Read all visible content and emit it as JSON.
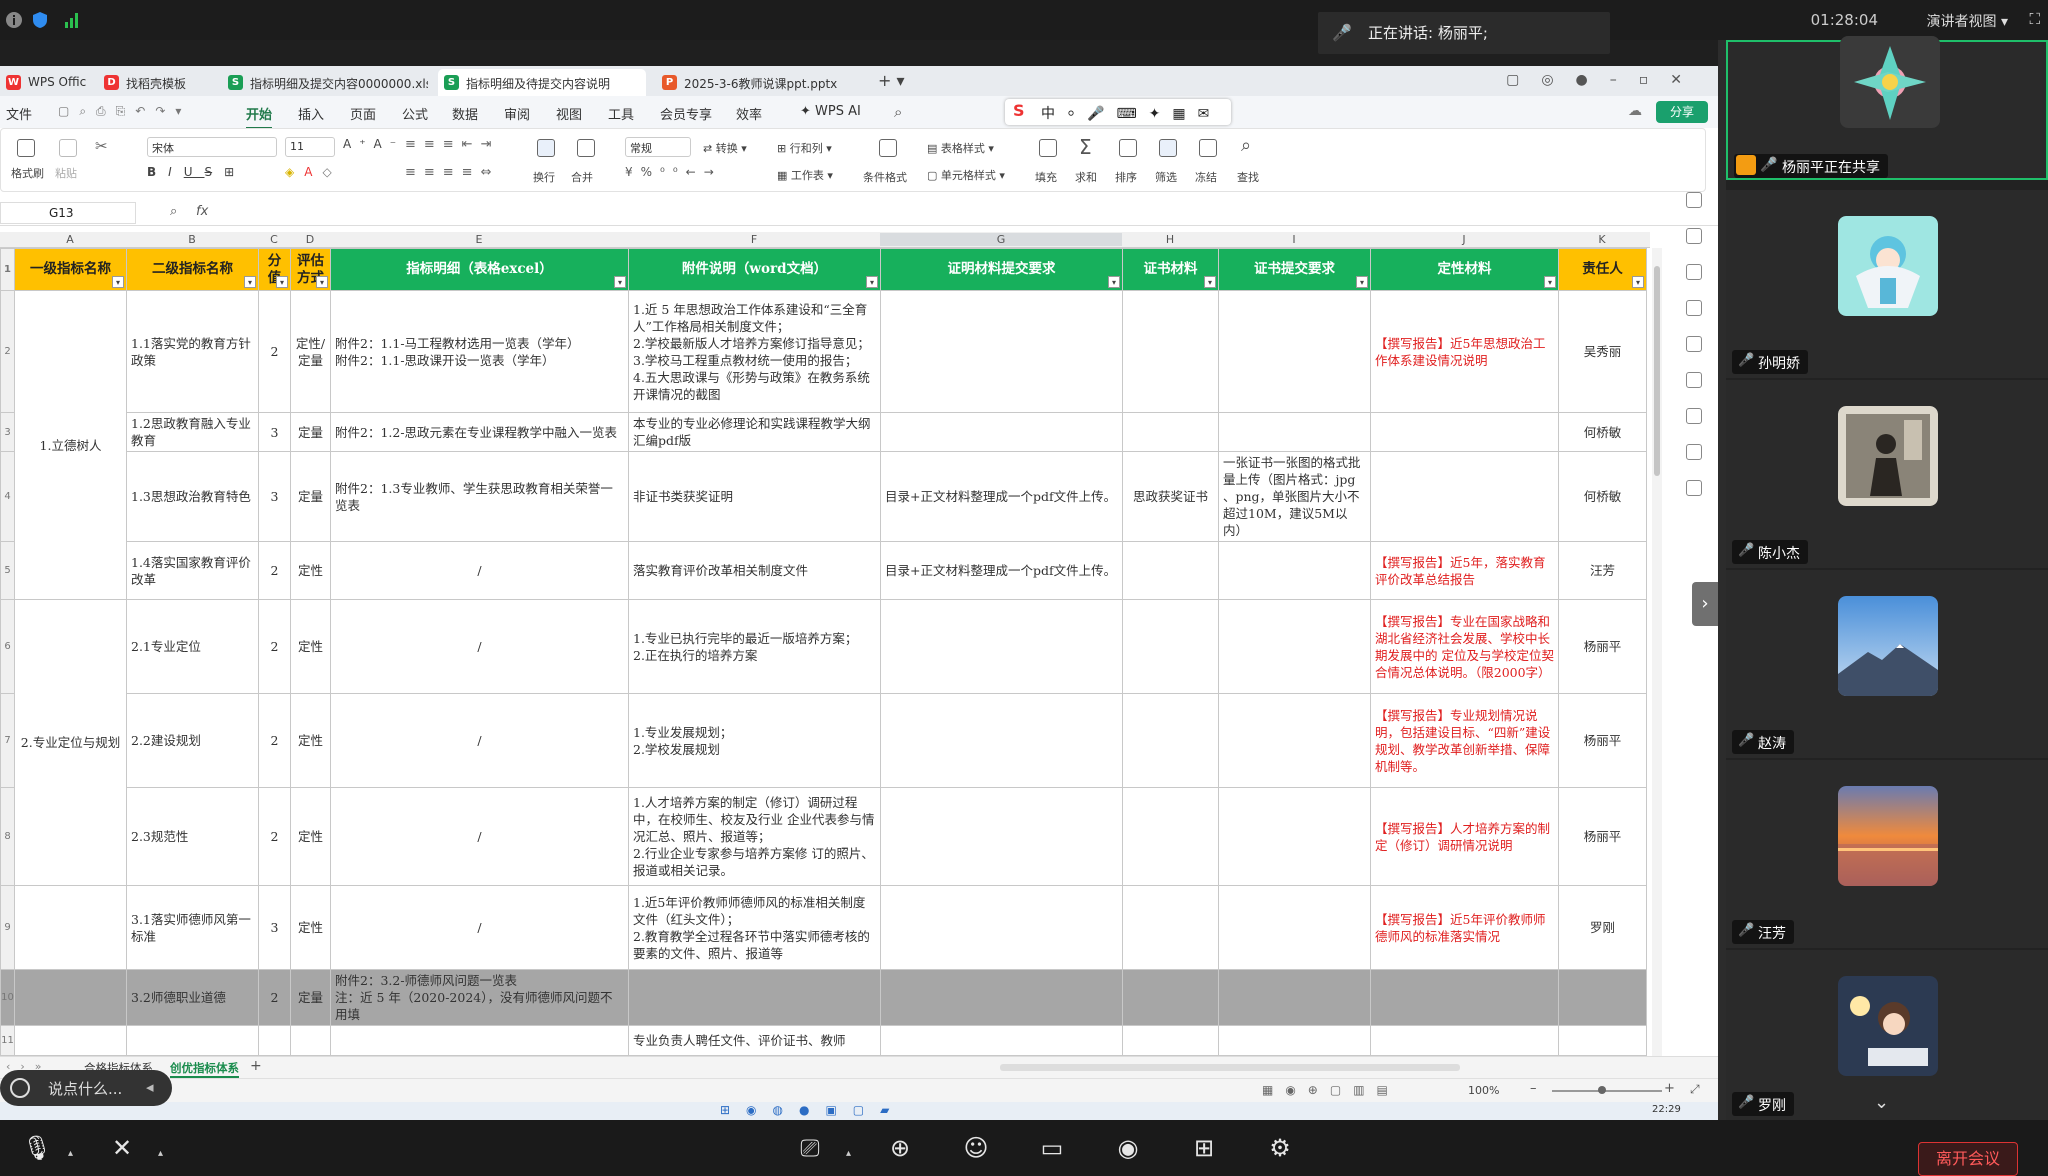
{
  "meeting": {
    "time": "01:28:04",
    "view_label": "演讲者视图",
    "speaking_prefix": "正在讲话:",
    "speaking_name": "杨丽平;",
    "leave_label": "离开会议",
    "chat_placeholder": "说点什么...",
    "colors": {
      "accent": "#1fbf6a",
      "leave": "#ff5a5a"
    }
  },
  "participants": [
    {
      "name": "杨丽平正在共享",
      "avatar": "flower-avatar",
      "sharing": true
    },
    {
      "name": "孙明娇",
      "avatar": "cartoon-angel-avatar"
    },
    {
      "name": "陈小杰",
      "avatar": "photo-avatar"
    },
    {
      "name": "赵涛",
      "avatar": "mountain-avatar"
    },
    {
      "name": "汪芳",
      "avatar": "sunset-avatar"
    },
    {
      "name": "罗刚",
      "avatar": "girl-reading-avatar"
    }
  ],
  "wps": {
    "tabs": [
      {
        "label": "WPS Office",
        "icon": "W",
        "color": "#e33"
      },
      {
        "label": "找稻壳模板",
        "icon": "D",
        "color": "#e33"
      },
      {
        "label": "指标明细及提交内容0000000.xls",
        "icon": "S",
        "color": "#1a9e55"
      },
      {
        "label": "指标明细及待提交内容说明",
        "icon": "S",
        "color": "#1a9e55"
      },
      {
        "label": "2025-3-6教师说课ppt.pptx",
        "icon": "P",
        "color": "#e8592a"
      }
    ],
    "menu": [
      "文件",
      "开始",
      "插入",
      "页面",
      "公式",
      "数据",
      "审阅",
      "视图",
      "工具",
      "会员专享",
      "效率",
      "WPS AI"
    ],
    "active_menu": "开始",
    "share_label": "分享",
    "ribbon": {
      "font_name": "宋体",
      "font_size": "11",
      "number_format": "常规",
      "labels": {
        "format_painter": "格式刷",
        "paste": "粘贴",
        "wrap": "换行",
        "merge": "合并",
        "convert": "转换",
        "rows_cols": "行和列",
        "worksheet": "工作表",
        "cond_format": "条件格式",
        "table_style": "表格样式",
        "cell_style": "单元格样式",
        "fill": "填充",
        "sum": "求和",
        "sort": "排序",
        "filter": "筛选",
        "freeze": "冻结",
        "find": "查找"
      }
    },
    "name_box": "G13",
    "fx": "fx",
    "col_letters": [
      "A",
      "B",
      "C",
      "D",
      "E",
      "F",
      "G",
      "H",
      "I",
      "J",
      "K"
    ],
    "sheet_tabs": [
      "合格指标体系",
      "创优指标体系"
    ],
    "active_sheet": "创优指标体系",
    "zoom": "100%",
    "clock": "22:29"
  },
  "table": {
    "headers": [
      "一级指标名称",
      "二级指标名称",
      "分值",
      "评估方式",
      "指标明细（表格excel）",
      "附件说明（word文档）",
      "证明材料提交要求",
      "证书材料",
      "证书提交要求",
      "定性材料",
      "责任人"
    ],
    "row_numbers": [
      "2",
      "3",
      "4",
      "5",
      "6",
      "7",
      "8",
      "9",
      "10",
      "11"
    ],
    "level1": [
      "1.立德树人",
      "2.专业定位与规划"
    ],
    "rows": [
      {
        "b": "1.1落实党的教育方针政策",
        "c": "2",
        "d": "定性/定量",
        "e": "附件2：1.1-马工程教材选用一览表（学年）\n附件2：1.1-思政课开设一览表（学年）",
        "f": "1.近 5 年思想政治工作体系建设和“三全育人”工作格局相关制度文件；\n2.学校最新版人才培养方案修订指导意见；\n3.学校马工程重点教材统一使用的报告；\n4.五大思政课与《形势与政策》在教务系统开课情况的截图",
        "g": "",
        "h": "",
        "i": "",
        "j": "【撰写报告】近5年思想政治工作体系建设情况说明",
        "k": "吴秀丽"
      },
      {
        "b": "1.2思政教育融入专业教育",
        "c": "3",
        "d": "定量",
        "e": "附件2：1.2-思政元素在专业课程教学中融入一览表",
        "f": "本专业的专业必修理论和实践课程教学大纲汇编pdf版",
        "g": "",
        "h": "",
        "i": "",
        "j": "",
        "k": "何桥敏"
      },
      {
        "b": "1.3思想政治教育特色",
        "c": "3",
        "d": "定量",
        "e": "附件2：1.3专业教师、学生获思政教育相关荣誉一览表",
        "f": "非证书类获奖证明",
        "g": "目录+正文材料整理成一个pdf文件上传。",
        "h": "思政获奖证书",
        "i": "一张证书一张图的格式批量上传（图片格式：jpg 、png，单张图片大小不超过10M，建议5M以内）",
        "j": "",
        "k": "何桥敏"
      },
      {
        "b": "1.4落实国家教育评价改革",
        "c": "2",
        "d": "定性",
        "e": "/",
        "f": "落实教育评价改革相关制度文件",
        "g": "目录+正文材料整理成一个pdf文件上传。",
        "h": "",
        "i": "",
        "j": "【撰写报告】近5年，落实教育评价改革总结报告",
        "k": "汪芳"
      },
      {
        "b": "2.1专业定位",
        "c": "2",
        "d": "定性",
        "e": "/",
        "f": "1.专业已执行完毕的最近一版培养方案；\n2.正在执行的培养方案",
        "g": "",
        "h": "",
        "i": "",
        "j": "【撰写报告】专业在国家战略和湖北省经济社会发展、学校中长期发展中的 定位及与学校定位契合情况总体说明。（限2000字）",
        "k": "杨丽平"
      },
      {
        "b": "2.2建设规划",
        "c": "2",
        "d": "定性",
        "e": "/",
        "f": "1.专业发展规划；\n2.学校发展规划",
        "g": "",
        "h": "",
        "i": "",
        "j": "【撰写报告】专业规划情况说明，包括建设目标、“四新”建设规划、教学改革创新举措、保障机制等。",
        "k": "杨丽平"
      },
      {
        "b": "2.3规范性",
        "c": "2",
        "d": "定性",
        "e": "/",
        "f": "1.人才培养方案的制定（修订）调研过程中，在校师生、校友及行业 企业代表参与情况汇总、照片、报道等；\n2.行业企业专家参与培养方案修 订的照片、报道或相关记录。",
        "g": "",
        "h": "",
        "i": "",
        "j": "【撰写报告】人才培养方案的制定（修订）调研情况说明",
        "k": "杨丽平"
      },
      {
        "b": "3.1落实师德师风第一标准",
        "c": "3",
        "d": "定性",
        "e": "/",
        "f": "1.近5年评价教师师德师风的标准相关制度文件（红头文件）；\n2.教育教学全过程各环节中落实师德考核的要素的文件、照片、报道等",
        "g": "",
        "h": "",
        "i": "",
        "j": "【撰写报告】近5年评价教师师德师风的标准落实情况",
        "k": "罗刚"
      },
      {
        "b": "3.2师德职业道德",
        "c": "2",
        "d": "定量",
        "e": "附件2：3.2-师德师风问题一览表\n注：近 5 年（2020-2024），没有师德师风问题不用填",
        "f": "",
        "g": "",
        "h": "",
        "i": "",
        "j": "",
        "k": ""
      },
      {
        "b": "",
        "c": "",
        "d": "",
        "e": "",
        "f": "专业负责人聘任文件、评价证书、教师",
        "g": "",
        "h": "",
        "i": "",
        "j": "",
        "k": ""
      }
    ]
  }
}
